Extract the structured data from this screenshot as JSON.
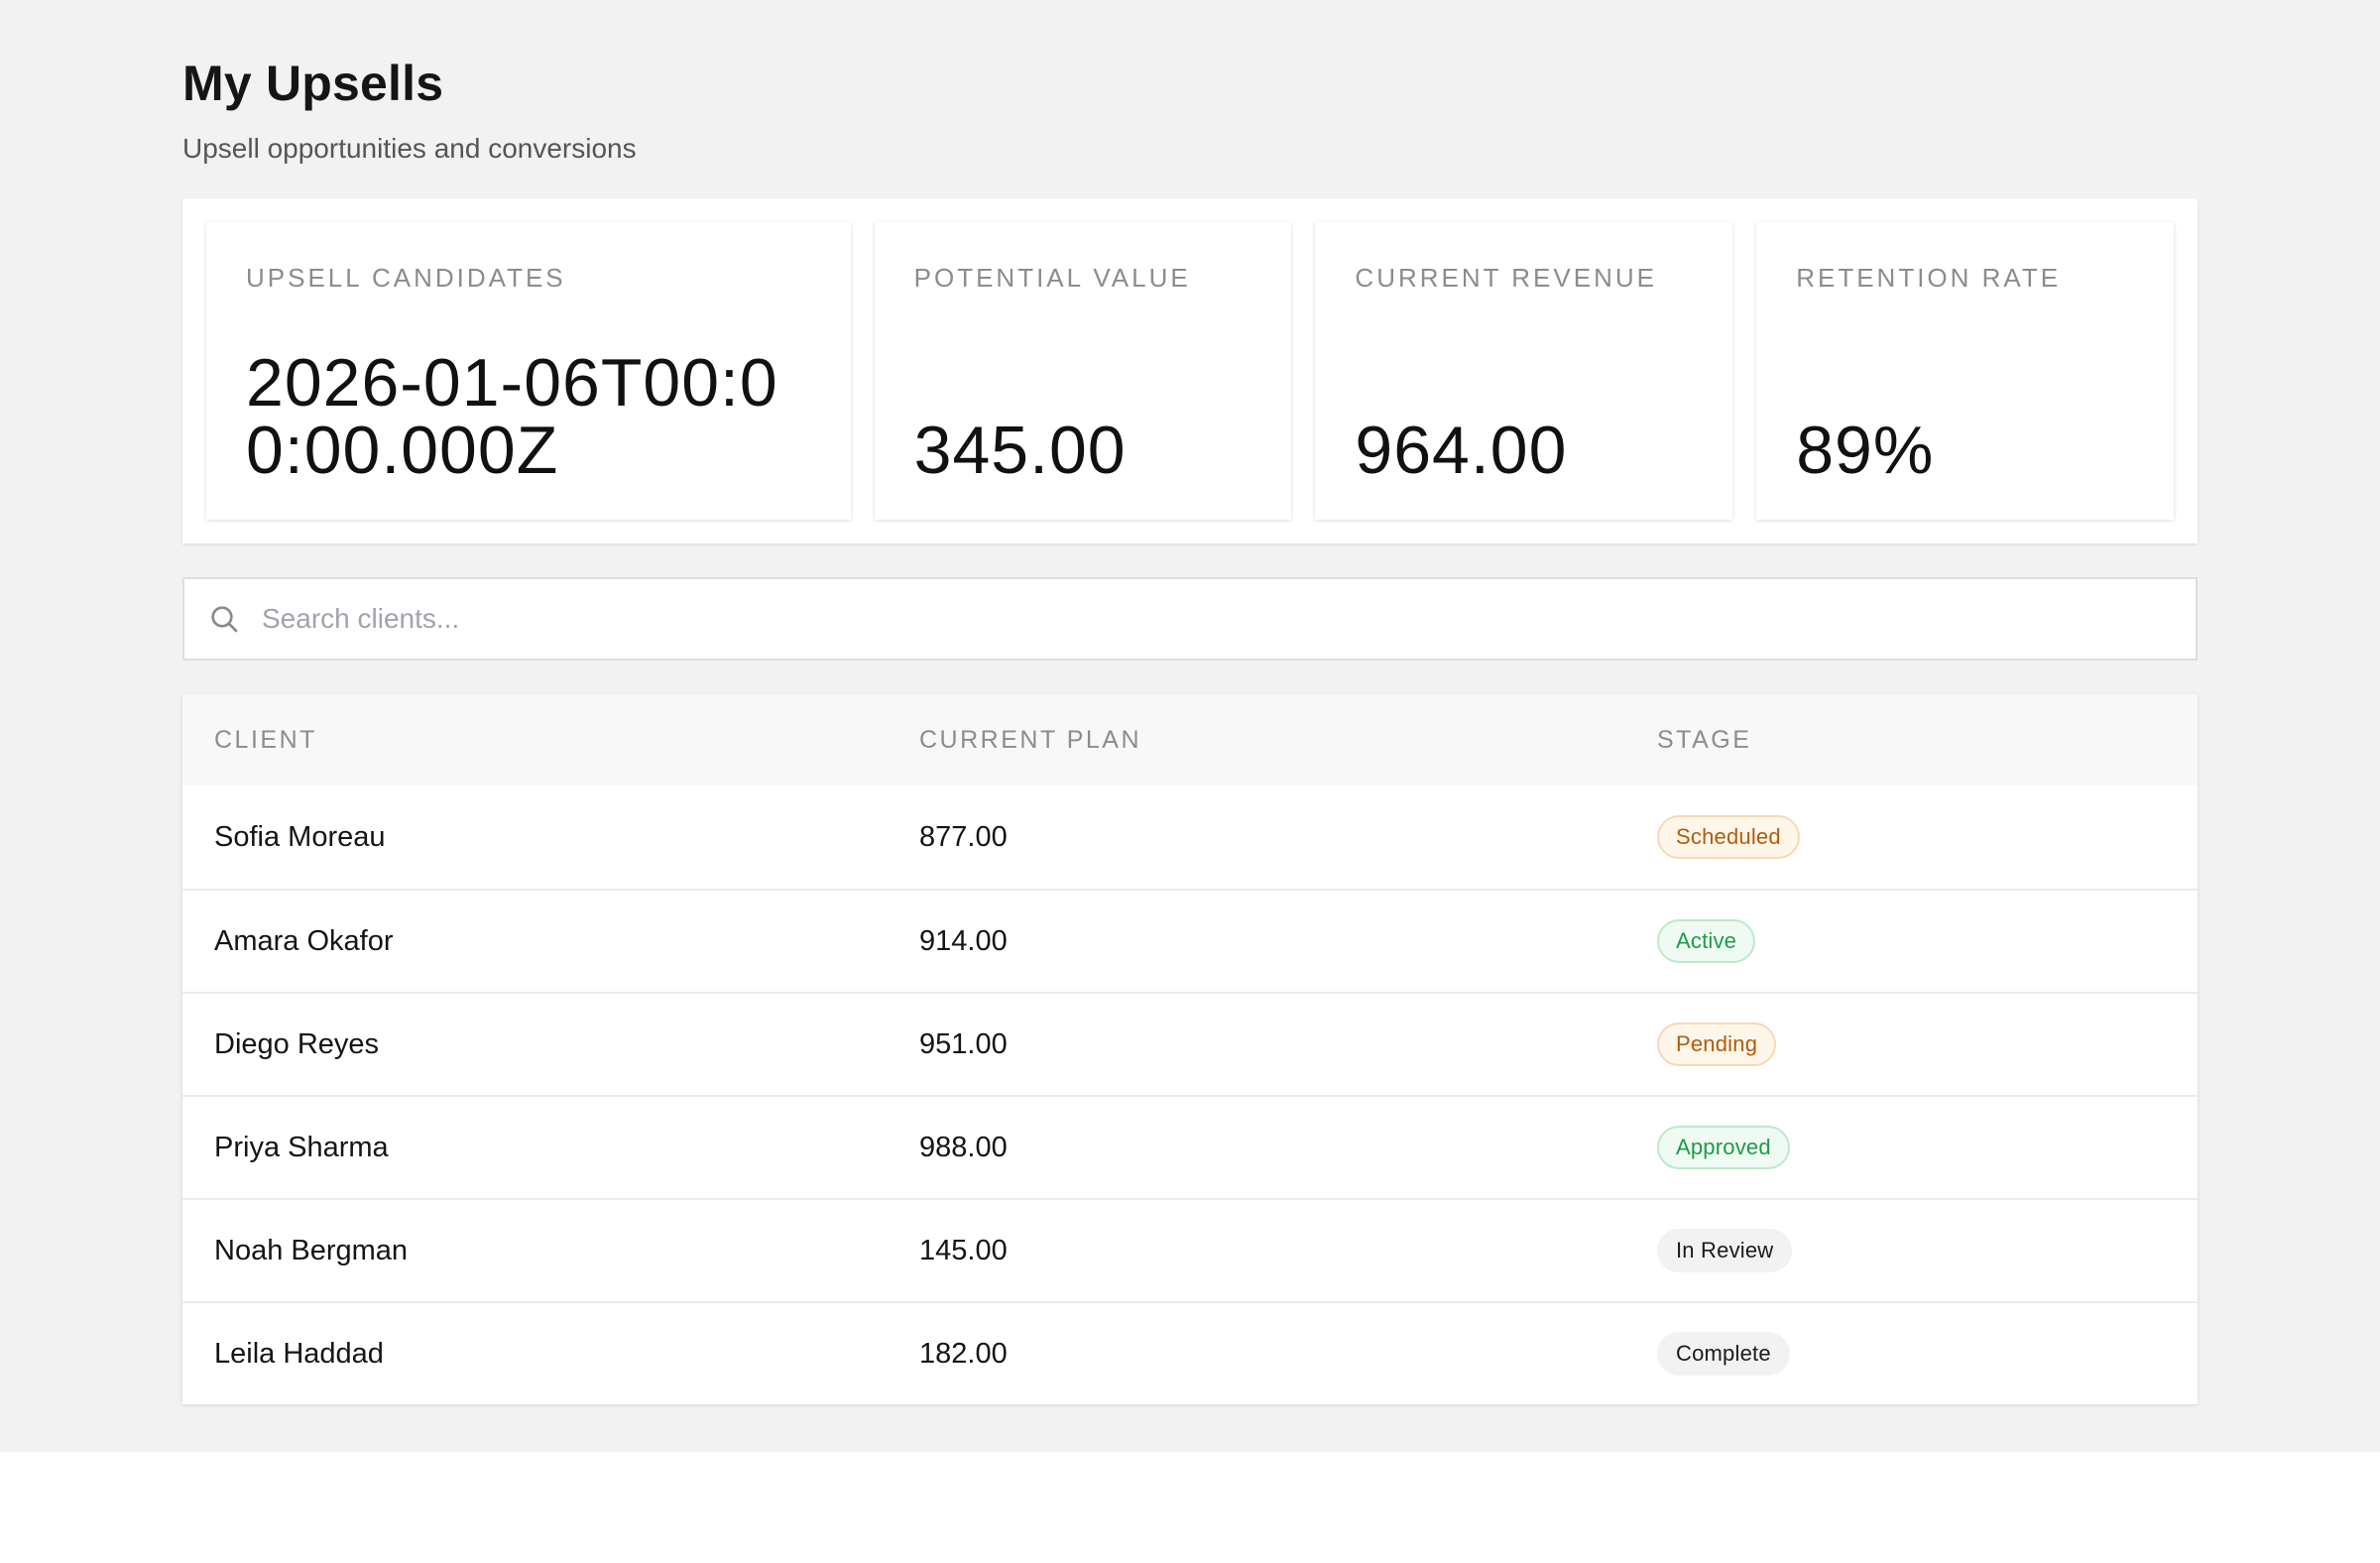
{
  "header": {
    "title": "My Upsells",
    "subtitle": "Upsell opportunities and conversions"
  },
  "stats": [
    {
      "label": "UPSELL CANDIDATES",
      "value": "2026-01-06T00:00:00.000Z"
    },
    {
      "label": "POTENTIAL VALUE",
      "value": "345.00"
    },
    {
      "label": "CURRENT REVENUE",
      "value": "964.00"
    },
    {
      "label": "RETENTION RATE",
      "value": "89%"
    }
  ],
  "search": {
    "placeholder": "Search clients...",
    "value": "",
    "icon": "search-icon"
  },
  "table": {
    "columns": [
      "CLIENT",
      "CURRENT PLAN",
      "STAGE"
    ],
    "rows": [
      {
        "client": "Sofia Moreau",
        "plan": "877.00",
        "stage": "Scheduled"
      },
      {
        "client": "Amara Okafor",
        "plan": "914.00",
        "stage": "Active"
      },
      {
        "client": "Diego Reyes",
        "plan": "951.00",
        "stage": "Pending"
      },
      {
        "client": "Priya Sharma",
        "plan": "988.00",
        "stage": "Approved"
      },
      {
        "client": "Noah Bergman",
        "plan": "145.00",
        "stage": "In Review"
      },
      {
        "client": "Leila Haddad",
        "plan": "182.00",
        "stage": "Complete"
      }
    ]
  },
  "colors": {
    "page_background": "#f2f2f2",
    "badge_warning_text": "#b25b0c",
    "badge_success_text": "#1f9a4a",
    "badge_neutral_text": "#1b1b1b"
  }
}
